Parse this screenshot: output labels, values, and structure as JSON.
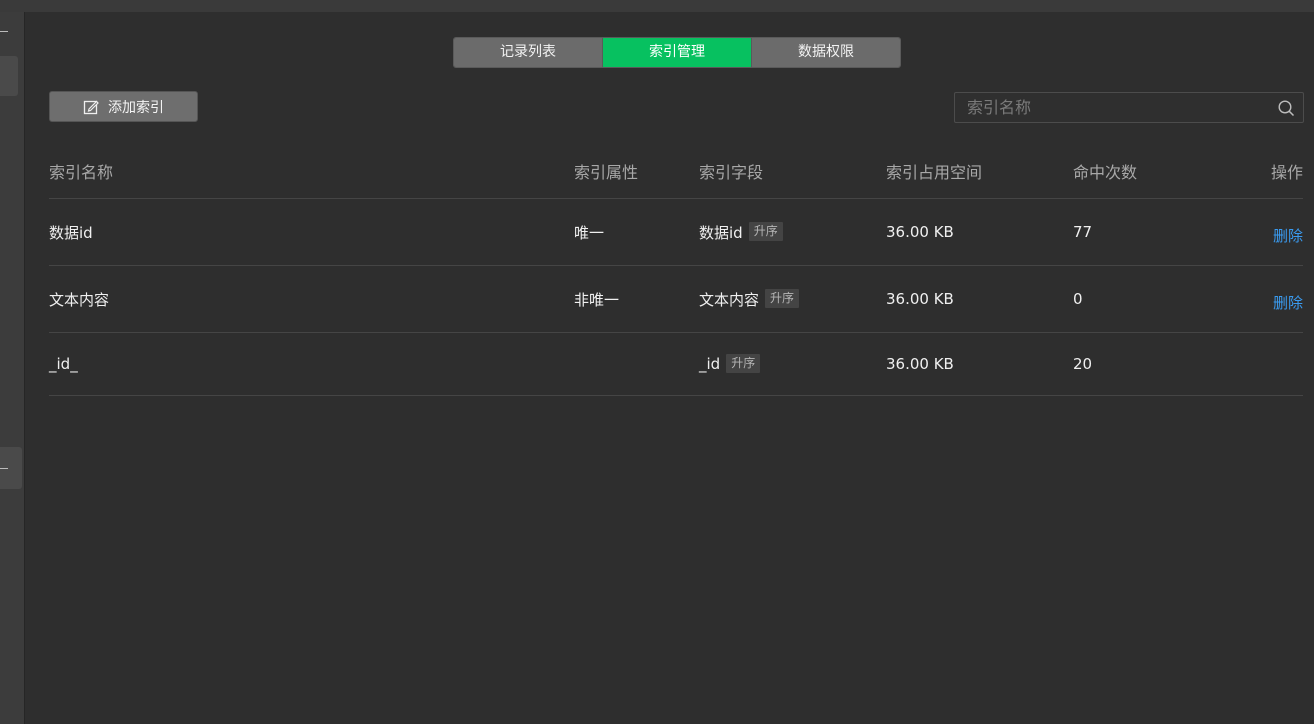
{
  "tabs": [
    {
      "label": "记录列表",
      "active": false
    },
    {
      "label": "索引管理",
      "active": true
    },
    {
      "label": "数据权限",
      "active": false
    }
  ],
  "toolbar": {
    "add_label": "添加索引",
    "add_icon": "edit-icon",
    "search_placeholder": "索引名称",
    "search_icon": "search-icon"
  },
  "table": {
    "columns": [
      "索引名称",
      "索引属性",
      "索引字段",
      "索引占用空间",
      "命中次数",
      "操作"
    ],
    "rows": [
      {
        "name": "数据id",
        "attr": "唯一",
        "field": "数据id",
        "order": "升序",
        "size": "36.00 KB",
        "hits": "77",
        "op": "删除"
      },
      {
        "name": "文本内容",
        "attr": "非唯一",
        "field": "文本内容",
        "order": "升序",
        "size": "36.00 KB",
        "hits": "0",
        "op": "删除"
      },
      {
        "name": "_id_",
        "attr": "",
        "field": "_id",
        "order": "升序",
        "size": "36.00 KB",
        "hits": "20",
        "op": ""
      }
    ]
  },
  "colors": {
    "accent": "#07c160",
    "link": "#3a9bf0",
    "background": "#2e2e2e"
  }
}
